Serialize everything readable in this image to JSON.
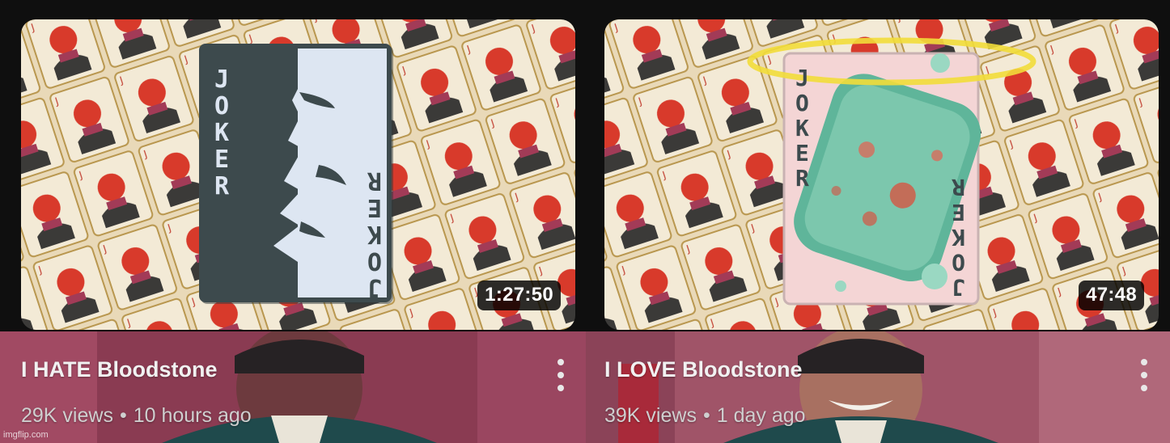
{
  "videos": [
    {
      "title": "I HATE Bloodstone",
      "views": "29K views",
      "separator": "•",
      "age": "10 hours ago",
      "duration": "1:27:50",
      "card_text": "JOKER"
    },
    {
      "title": "I LOVE Bloodstone",
      "views": "39K views",
      "separator": "•",
      "age": "1 day ago",
      "duration": "47:48",
      "card_text": "JOKER"
    }
  ],
  "watermark": "imgflip.com",
  "colors": {
    "background": "#0f0f0f",
    "card_dark": "#3d4a4d",
    "card_light": "#dde6f2",
    "card_pink": "#f4d5d5",
    "gem": "#5fb59a",
    "halo": "#f2dd3a",
    "meta_bg_left": "#8a3b52",
    "meta_bg_right": "#a05468"
  },
  "icons": [
    "more-vert-icon"
  ]
}
